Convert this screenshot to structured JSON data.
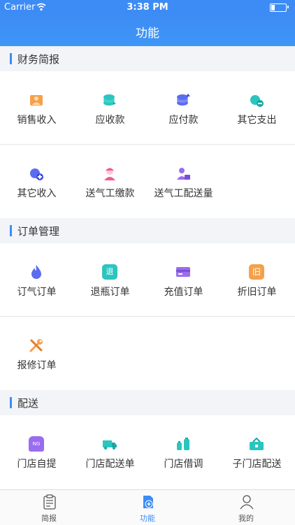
{
  "status_bar": {
    "carrier": "Carrier",
    "time": "3:38 PM"
  },
  "nav": {
    "title": "功能"
  },
  "sections": [
    {
      "title": "财务简报",
      "rows": [
        [
          {
            "label": "销售收入",
            "icon": "sales-income-icon"
          },
          {
            "label": "应收款",
            "icon": "receivables-icon"
          },
          {
            "label": "应付款",
            "icon": "payables-icon"
          },
          {
            "label": "其它支出",
            "icon": "other-expense-icon"
          }
        ],
        [
          {
            "label": "其它收入",
            "icon": "other-income-icon"
          },
          {
            "label": "送气工缴款",
            "icon": "courier-payment-icon"
          },
          {
            "label": "送气工配送量",
            "icon": "courier-delivery-volume-icon"
          }
        ]
      ]
    },
    {
      "title": "订单管理",
      "rows": [
        [
          {
            "label": "订气订单",
            "icon": "flame-icon"
          },
          {
            "label": "退瓶订单",
            "icon": "return-cylinder-icon",
            "glyph": "退"
          },
          {
            "label": "充值订单",
            "icon": "card-icon"
          },
          {
            "label": "折旧订单",
            "icon": "depreciation-icon",
            "glyph": "旧"
          }
        ],
        [
          {
            "label": "报修订单",
            "icon": "tools-icon"
          }
        ]
      ]
    },
    {
      "title": "配送",
      "rows": [
        [
          {
            "label": "门店自提",
            "icon": "store-pickup-icon",
            "glyph": "NG"
          },
          {
            "label": "门店配送单",
            "icon": "delivery-truck-icon"
          },
          {
            "label": "门店借调",
            "icon": "cylinder-transfer-icon"
          },
          {
            "label": "子门店配送",
            "icon": "sub-store-delivery-icon"
          }
        ]
      ]
    }
  ],
  "tabs": [
    {
      "label": "简报",
      "icon": "clipboard-icon",
      "active": false
    },
    {
      "label": "功能",
      "icon": "function-add-icon",
      "active": true
    },
    {
      "label": "我的",
      "icon": "person-icon",
      "active": false
    }
  ],
  "colors": {
    "primary": "#3d8cf5",
    "orange": "#f5a04a",
    "teal": "#2bc5c0",
    "indigo": "#5b6cf0",
    "purple": "#9a6cf0",
    "pink": "#f25a8f"
  }
}
